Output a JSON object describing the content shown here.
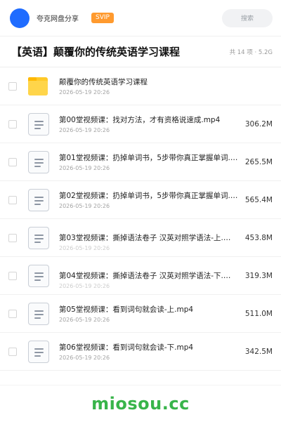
{
  "header": {
    "owner": "夸克网盘分享",
    "badge": "SVIP",
    "search_label": "搜索"
  },
  "share": {
    "title": "【英语】颠覆你的传统英语学习课程",
    "summary": "共 14 项 · 5.2G"
  },
  "items": [
    {
      "name": "颠覆你的传统英语学习课程",
      "date": "2026-05-19 20:26",
      "size": "",
      "icon": "folder-icon"
    },
    {
      "name": "第00堂视频课：找对方法，才有资格说速成.mp4",
      "date": "2026-05-19 20:26",
      "size": "306.2M",
      "icon": "file-icon"
    },
    {
      "name": "第01堂视频课：扔掉单词书，5步带你真正掌握单词.mp4",
      "date": "2026-05-19 20:26",
      "size": "265.5M",
      "icon": "file-icon"
    },
    {
      "name": "第02堂视频课：扔掉单词书，5步带你真正掌握单词.mp4",
      "date": "2026-05-19 20:26",
      "size": "565.4M",
      "icon": "file-icon"
    },
    {
      "name": "第03堂视频课：撕掉语法卷子 汉英对照学语法-上.…",
      "date": "2026-05-19 20:26",
      "size": "453.8M",
      "icon": "file-icon"
    },
    {
      "name": "第04堂视频课：撕掉语法卷子 汉英对照学语法-下.…",
      "date": "2026-05-19 20:26",
      "size": "319.3M",
      "icon": "file-icon"
    },
    {
      "name": "第05堂视频课：看到词句就会读-上.mp4",
      "date": "2026-05-19 20:26",
      "size": "511.0M",
      "icon": "file-icon"
    },
    {
      "name": "第06堂视频课：看到词句就会读-下.mp4",
      "date": "2026-05-19 20:26",
      "size": "342.5M",
      "icon": "file-icon"
    }
  ],
  "footer": {
    "brand": "miosou.cc"
  }
}
